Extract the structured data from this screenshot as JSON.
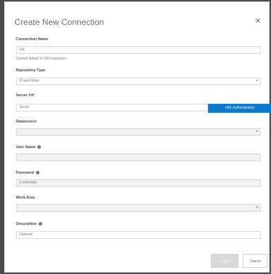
{
  "dialog": {
    "title": "Create New Connection",
    "close_glyph": "×"
  },
  "form": {
    "connection_name": {
      "label": "Connection Name",
      "value": "Ivib",
      "hint": "Content limited to 100 characters"
    },
    "repository_type": {
      "label": "Repository Type",
      "value": "Project Arbor"
    },
    "server_url": {
      "label": "Server Url",
      "placeholder": "Server",
      "button": "URL Authentication"
    },
    "datasource": {
      "label": "Datasource"
    },
    "user_name": {
      "label": "User Name"
    },
    "password": {
      "label": "Password",
      "placeholder": "Credentials"
    },
    "work_area": {
      "label": "Work Area"
    },
    "description": {
      "label": "Description",
      "placeholder": "Optional"
    }
  },
  "footer": {
    "create_label": "Create",
    "cancel_label": "Cancel"
  },
  "icons": {
    "close": "close-icon",
    "dropdown": "chevron-down-icon",
    "info": "info-icon"
  },
  "colors": {
    "accent": "#0b7ad1"
  }
}
